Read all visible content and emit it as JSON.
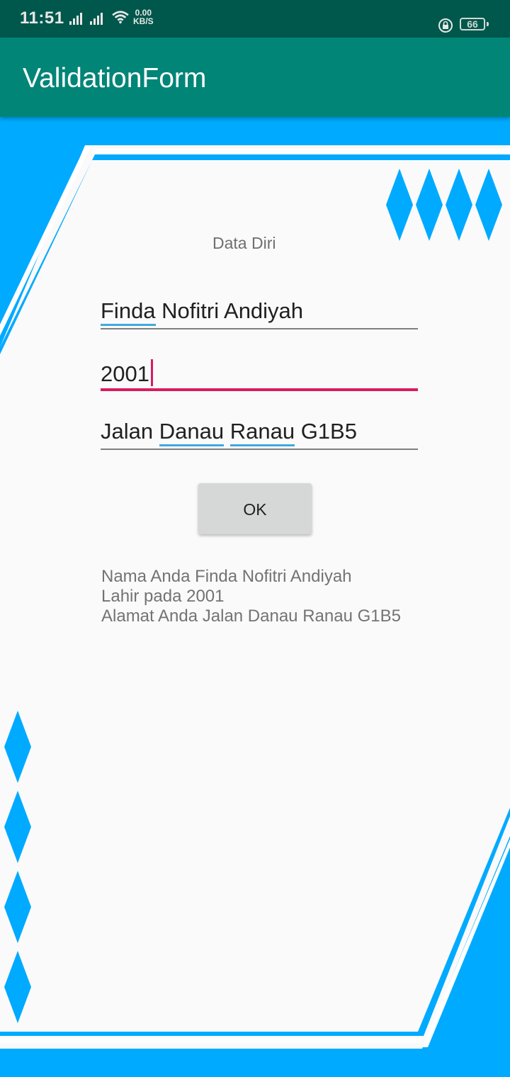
{
  "status_bar": {
    "time": "11:51",
    "net_speed_value": "0.00",
    "net_speed_unit": "KB/S",
    "battery": "66",
    "icons": [
      "signal-icon",
      "signal-icon",
      "wifi-icon",
      "rotation-lock-icon",
      "battery-icon"
    ]
  },
  "app_bar": {
    "title": "ValidationForm"
  },
  "form": {
    "header": "Data Diri",
    "name_field": {
      "value": "Finda Nofitri Andiyah",
      "spell_word": "Finda",
      "rest": " Nofitri Andiyah"
    },
    "year_field": {
      "value": "2001",
      "focused": true
    },
    "address_field": {
      "value": "Jalan Danau Ranau G1B5",
      "part1": "Jalan ",
      "spell1": "Danau",
      "part2": " ",
      "spell2": "Ranau",
      "part3": " G1B5"
    },
    "ok_label": "OK"
  },
  "result": {
    "line1": "Nama Anda Finda Nofitri Andiyah",
    "line2": "Lahir pada 2001",
    "line3": "Alamat Anda Jalan Danau Ranau G1B5"
  },
  "colors": {
    "status_bar": "#00574b",
    "app_bar": "#008577",
    "accent": "#d81b60",
    "decor_blue": "#00aaff",
    "spell_underline": "#3fa9e0"
  }
}
